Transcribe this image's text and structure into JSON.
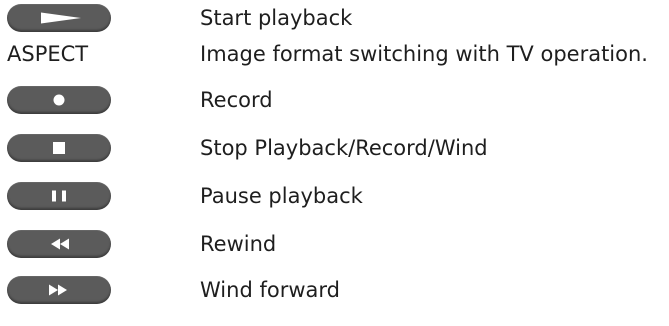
{
  "legend": [
    {
      "key_icon": "play-icon",
      "description": "Start playback"
    },
    {
      "key_label": "ASPECT",
      "description": "Image format switching with TV operation."
    },
    {
      "key_icon": "record-icon",
      "description": "Record"
    },
    {
      "key_icon": "stop-icon",
      "description": "Stop Playback/Record/Wind"
    },
    {
      "key_icon": "pause-icon",
      "description": "Pause playback"
    },
    {
      "key_icon": "rewind-icon",
      "description": "Rewind"
    },
    {
      "key_icon": "fast-forward-icon",
      "description": "Wind forward"
    }
  ],
  "colors": {
    "key_fill": "#5b5b5b",
    "symbol": "#ffffff",
    "text": "#1e1e1e"
  }
}
